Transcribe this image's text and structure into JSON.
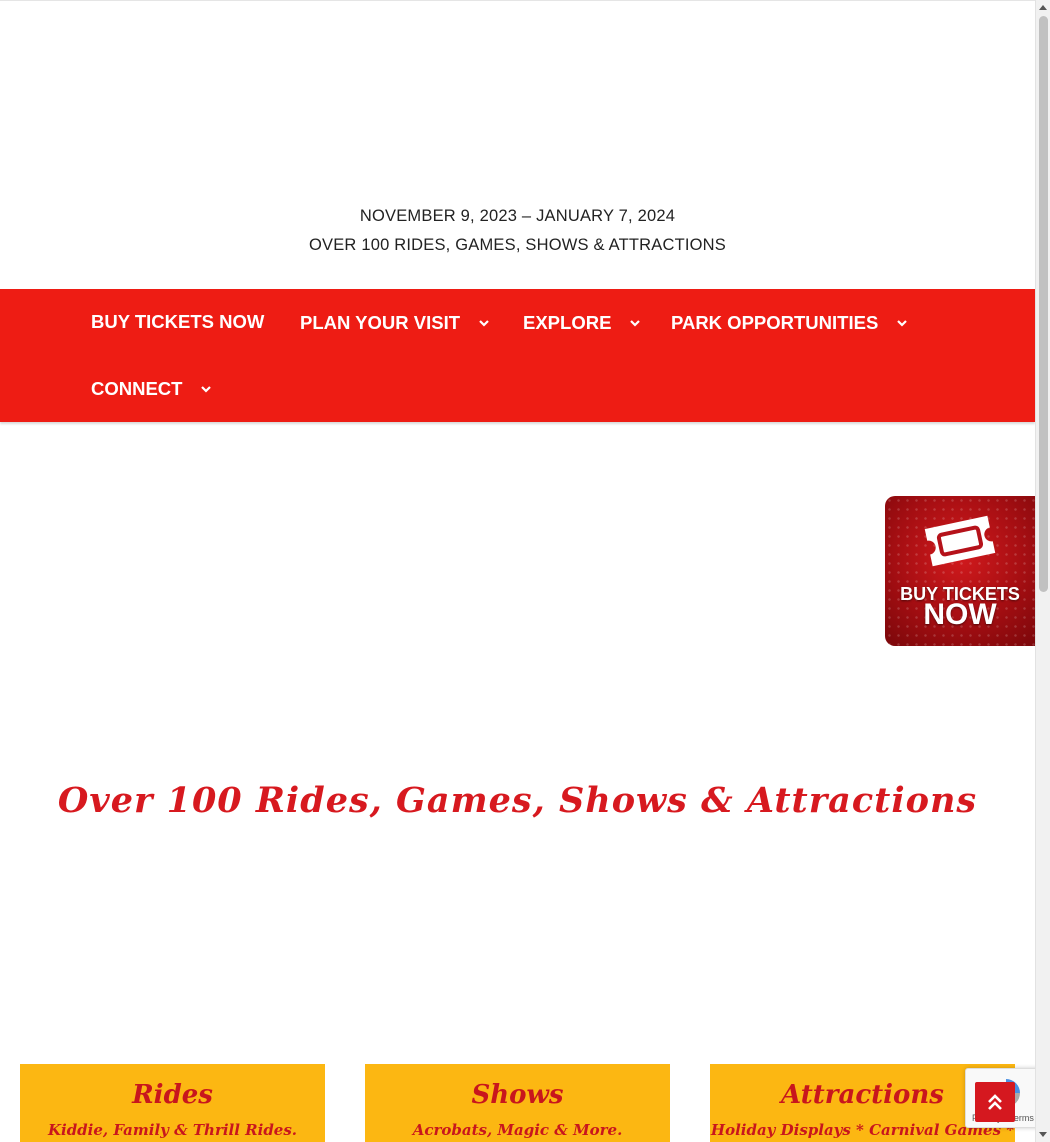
{
  "header": {
    "dates": "NOVEMBER 9, 2023 – JANUARY 7, 2024",
    "tagline": "OVER 100 RIDES, GAMES, SHOWS & ATTRACTIONS"
  },
  "nav": {
    "items": [
      {
        "label": "BUY TICKETS NOW",
        "has_dropdown": false
      },
      {
        "label": "PLAN YOUR VISIT",
        "has_dropdown": true
      },
      {
        "label": "EXPLORE",
        "has_dropdown": true
      },
      {
        "label": "PARK OPPORTUNITIES",
        "has_dropdown": true
      },
      {
        "label": "CONNECT",
        "has_dropdown": true
      }
    ]
  },
  "ticket_badge": {
    "line1": "BUY TICKETS",
    "line2": "NOW"
  },
  "main": {
    "headline": "Over 100 Rides, Games, Shows & Attractions",
    "cards": [
      {
        "title": "Rides",
        "subtitle": "Kiddie, Family & Thrill Rides."
      },
      {
        "title": "Shows",
        "subtitle": "Acrobats, Magic & More."
      },
      {
        "title": "Attractions",
        "subtitle": "Holiday Displays * Carnival Games *"
      }
    ]
  },
  "recaptcha": {
    "text": "Privacy - Terms"
  },
  "colors": {
    "nav_red": "#ee1c14",
    "headline_red": "#d7191f",
    "card_yellow": "#fcb712"
  },
  "icons": {
    "dropdown": "chevron-down-icon",
    "to_top": "double-chevron-up-icon",
    "ticket": "ticket-icon",
    "recaptcha": "recaptcha-icon"
  }
}
